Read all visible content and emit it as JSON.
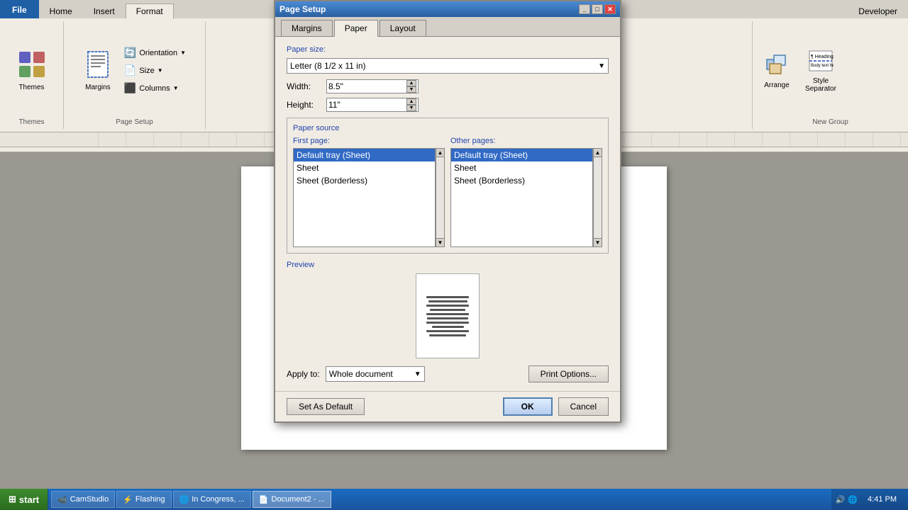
{
  "app": {
    "title": "Page Setup"
  },
  "ribbon": {
    "tabs": [
      {
        "id": "file",
        "label": "File"
      },
      {
        "id": "home",
        "label": "Home"
      },
      {
        "id": "insert",
        "label": "Insert"
      },
      {
        "id": "format",
        "label": "Format"
      },
      {
        "id": "developer",
        "label": "Developer"
      }
    ],
    "themes_group": {
      "label": "Themes",
      "btn_label": "Themes"
    },
    "page_setup_group": {
      "label": "Page Setup",
      "margins_label": "Margins",
      "orientation_label": "Orientation",
      "size_label": "Size",
      "columns_label": "Columns"
    },
    "developer_group": {
      "label": "New Group",
      "arrange_label": "Arrange",
      "style_separator_label": "Style\nSeparator"
    }
  },
  "dialog": {
    "title": "Page Setup",
    "tabs": [
      "Margins",
      "Paper",
      "Layout"
    ],
    "active_tab": "Paper",
    "paper_size_label": "Paper size:",
    "paper_size_value": "Letter (8 1/2 x 11 in)",
    "width_label": "Width:",
    "width_value": "8.5\"",
    "height_label": "Height:",
    "height_value": "11\"",
    "paper_source_label": "Paper source",
    "first_page_label": "First page:",
    "other_pages_label": "Other pages:",
    "first_page_items": [
      "Default tray (Sheet)",
      "Sheet",
      "Sheet (Borderless)"
    ],
    "first_page_selected": 0,
    "other_pages_items": [
      "Default tray (Sheet)",
      "Sheet",
      "Sheet (Borderless)"
    ],
    "other_pages_selected": 0,
    "preview_label": "Preview",
    "apply_to_label": "Apply to:",
    "apply_to_value": "Whole document",
    "print_options_label": "Print Options...",
    "set_as_default_label": "Set As Default",
    "ok_label": "OK",
    "cancel_label": "Cancel"
  },
  "taskbar": {
    "start_label": "start",
    "items": [
      {
        "label": "CamStudio",
        "icon": "📹"
      },
      {
        "label": "Flashing",
        "icon": "⚡"
      },
      {
        "label": "In Congress, ...",
        "icon": "🌐"
      },
      {
        "label": "Document2 - ...",
        "icon": "📄"
      }
    ],
    "clock": "4:41 PM"
  }
}
